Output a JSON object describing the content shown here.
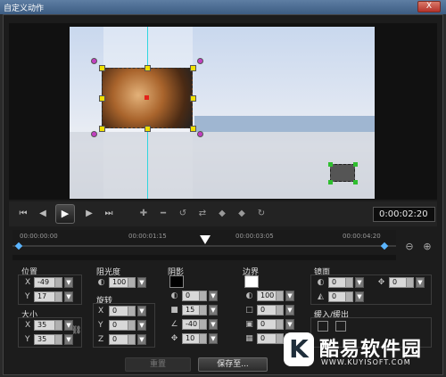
{
  "window": {
    "title": "自定义动作",
    "close_label": "X"
  },
  "transport": {
    "icons": [
      "go-start-icon",
      "prev-frame-icon",
      "play-icon",
      "next-frame-icon",
      "go-end-icon"
    ],
    "timecode": "0:00:02:20",
    "keyframe_icons": [
      "add-keyframe-icon",
      "remove-keyframe-icon",
      "reverse-keyframe-icon",
      "swap-keyframe-icon",
      "move-left-icon",
      "move-right-icon",
      "goto-keyframe-icon"
    ]
  },
  "ruler": {
    "labels": [
      "00:00:00:00",
      "00:00:01:15",
      "00:00:03:05",
      "00:00:04:20"
    ],
    "zoom_out": "⊖",
    "zoom_in": "⊕"
  },
  "position": {
    "title": "位置",
    "x_label": "X",
    "x": "-49",
    "y_label": "Y",
    "y": "17"
  },
  "size": {
    "title": "大小",
    "x_label": "X",
    "x": "35",
    "y_label": "Y",
    "y": "35"
  },
  "opacity": {
    "title": "阻光度",
    "value": "100"
  },
  "rotation": {
    "title": "旋转",
    "x_label": "X",
    "x": "0",
    "y_label": "Y",
    "y": "0",
    "z_label": "Z",
    "z": "0"
  },
  "shadow": {
    "title": "阴影",
    "opacity": "0",
    "blur": "15",
    "angle": "-40",
    "distance": "10",
    "color": "#000000"
  },
  "border": {
    "title": "边界",
    "opacity": "100",
    "width": "0",
    "softness": "0",
    "extra": "0",
    "color": "#ffffff"
  },
  "mirror": {
    "title": "镜面",
    "opacity": "0",
    "offset": "0",
    "gap": "0"
  },
  "fade": {
    "title": "缓入/缓出"
  },
  "buttons": {
    "reset": "重置",
    "save": "保存至..."
  },
  "watermark": {
    "logo": "K",
    "title": "酷易软件园",
    "url": "WWW.KUYISOFT.COM"
  }
}
